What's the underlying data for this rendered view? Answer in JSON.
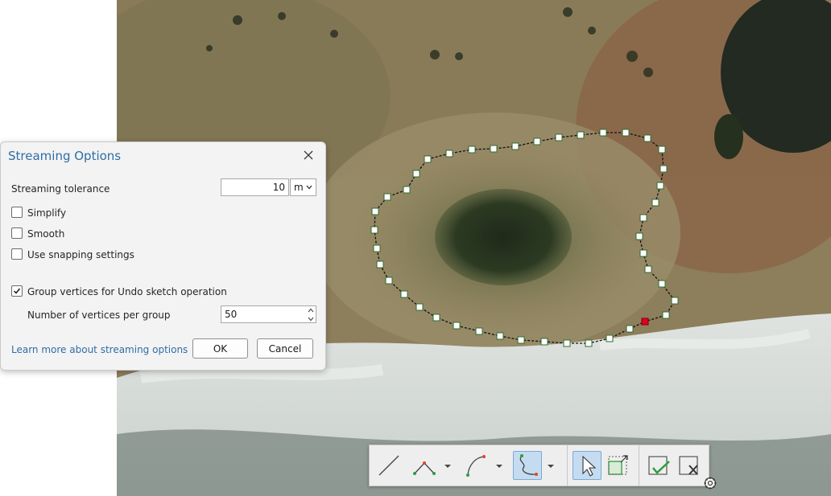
{
  "dialog": {
    "title": "Streaming Options",
    "streaming_tolerance_label": "Streaming tolerance",
    "streaming_tolerance_value": "10",
    "unit": "m",
    "simplify_label": "Simplify",
    "simplify_checked": false,
    "smooth_label": "Smooth",
    "smooth_checked": false,
    "snapping_label": "Use snapping settings",
    "snapping_checked": false,
    "group_vertices_label": "Group vertices for Undo sketch operation",
    "group_vertices_checked": true,
    "vertices_per_group_label": "Number of vertices per group",
    "vertices_per_group_value": "50",
    "learn_more_link": "Learn more about streaming options",
    "ok_label": "OK",
    "cancel_label": "Cancel"
  },
  "toolbar": {
    "tools": [
      {
        "name": "line-tool",
        "active": false
      },
      {
        "name": "polyline-tool",
        "active": false
      },
      {
        "name": "arc-tool",
        "active": false
      },
      {
        "name": "streaming-tool",
        "active": true
      },
      {
        "name": "select-tool",
        "active": true
      },
      {
        "name": "resize-tool",
        "active": false
      },
      {
        "name": "finish-sketch-tool",
        "active": false
      },
      {
        "name": "clear-sketch-tool",
        "active": false
      }
    ]
  },
  "colors": {
    "accent": "#2e6da4",
    "active_tool": "#c5dcf0",
    "vertex_fill": "#ffffff",
    "vertex_stroke": "#2f6b2f",
    "active_vertex": "#e0001b",
    "check_green": "#2e9e3e"
  }
}
